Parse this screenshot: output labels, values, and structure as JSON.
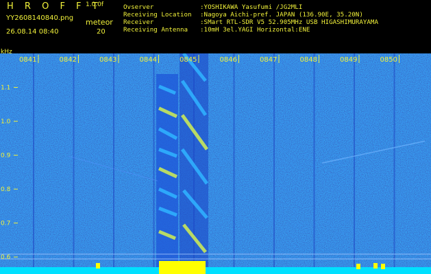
{
  "header": {
    "title": "H R O F F T",
    "version": "1.0.0f",
    "filename": "YY2608140840.png",
    "datetime": "26.08.14 08:40",
    "meteor_label": "meteor",
    "meteor_count": "20"
  },
  "info": [
    {
      "key": "Ovserver",
      "value": ":YOSHIKAWA Yasufumi /JG2MLI"
    },
    {
      "key": "Receiving Location",
      "value": ":Nagoya Aichi-pref. JAPAN (136.90E, 35.20N)"
    },
    {
      "key": "Receiver",
      "value": ":SMart RTL-SDR V5 52.905MHz USB HIGASHIMURAYAMA"
    },
    {
      "key": "Receiving Antenna",
      "value": ":10mH 3el.YAGI Horizontal:ENE"
    }
  ],
  "chart_data": {
    "type": "heatmap",
    "ylabel": "kHz",
    "yticks": [
      "1.1",
      "1.0",
      "0.9",
      "0.8",
      "0.7",
      "0.6"
    ],
    "ytick_values": [
      1.1,
      1.0,
      0.9,
      0.8,
      0.7,
      0.6
    ],
    "ylim": [
      0.57,
      1.2
    ],
    "xticks": [
      "0841",
      "0842",
      "0843",
      "0844",
      "0845",
      "0846",
      "0847",
      "0848",
      "0849",
      "0850"
    ],
    "colors": {
      "background": "#0a1a7a",
      "signal": "#2fb0ff",
      "strong": "#c8e85a",
      "baseline": "#00e0ff",
      "burst": "#ffff00"
    }
  }
}
